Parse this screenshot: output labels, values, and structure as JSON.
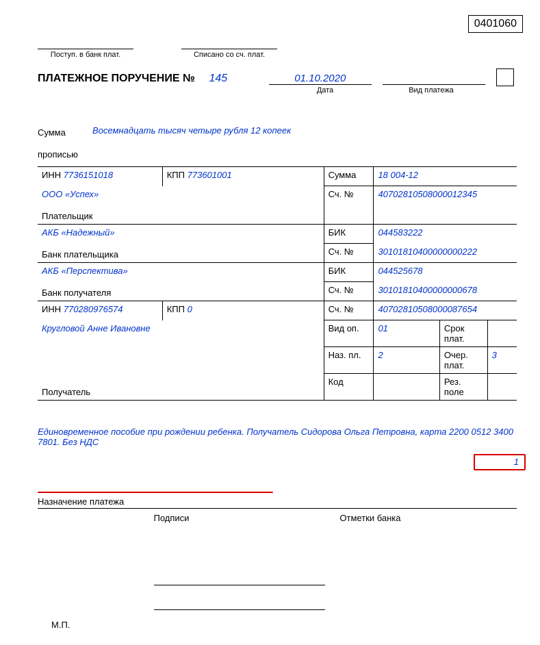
{
  "form_code": "0401060",
  "top": {
    "postup_label": "Поступ. в банк плат.",
    "spisano_label": "Списано со сч. плат."
  },
  "title": "ПЛАТЕЖНОЕ ПОРУЧЕНИЕ №",
  "number": "145",
  "date": "01.10.2020",
  "date_label": "Дата",
  "vid_platezha_label": "Вид платежа",
  "amount_words_label1": "Сумма",
  "amount_words_label2": "прописью",
  "amount_words": "Восемнадцать тысяч четыре рубля 12 копеек",
  "row1": {
    "inn_lbl": "ИНН",
    "inn": "7736151018",
    "kpp_lbl": "КПП",
    "kpp": "773601001",
    "sum_lbl": "Сумма",
    "sum": "18 004-12"
  },
  "payer_name": "ООО «Успех»",
  "sch_no_lbl": "Сч. №",
  "payer_acc": "40702810508000012345",
  "payer_lbl": "Плательщик",
  "payer_bank": "АКБ «Надежный»",
  "bik_lbl": "БИК",
  "payer_bank_bik": "044583222",
  "payer_bank_acc": "30101810400000000222",
  "payer_bank_lbl": "Банк плательщика",
  "recv_bank": "АКБ «Перспектива»",
  "recv_bank_bik": "044525678",
  "recv_bank_acc": "30101810400000000678",
  "recv_bank_lbl": "Банк получателя",
  "row2": {
    "inn_lbl": "ИНН",
    "inn": "770280976574",
    "kpp_lbl": "КПП",
    "kpp": "0",
    "sch_lbl": "Сч. №",
    "sch": "40702810508000087654"
  },
  "recv_name": "Кругловой Анне Ивановне",
  "vid_op_lbl": "Вид оп.",
  "vid_op": "01",
  "srok_lbl": "Срок плат.",
  "naz_pl_lbl": "Наз. пл.",
  "naz_pl": "2",
  "ocher_lbl": "Очер. плат.",
  "ocher": "3",
  "recv_lbl": "Получатель",
  "kod_lbl": "Код",
  "rez_lbl": "Рез. поле",
  "highlight_val": "1",
  "purpose": "Единовременное пособие при рождении ребенка. Получатель Сидорова Ольга Петровна, карта 2200 0512 3400 7801. Без НДС",
  "naz_platezha_lbl": "Назначение платежа",
  "podpisi_lbl": "Подписи",
  "otmetki_lbl": "Отметки банка",
  "mp_lbl": "М.П."
}
